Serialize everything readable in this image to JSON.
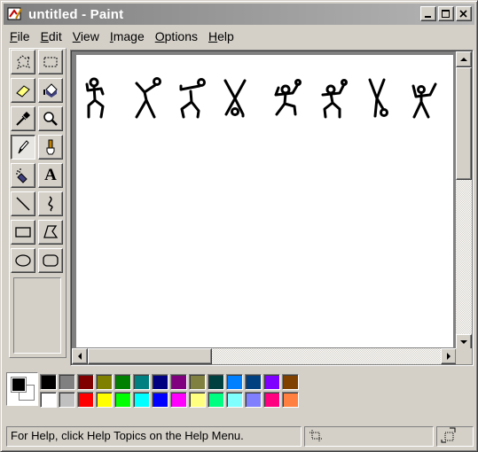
{
  "window": {
    "title": "untitled - Paint"
  },
  "titlebar": {
    "buttons": [
      "minimize",
      "maximize",
      "close"
    ]
  },
  "menubar": {
    "items": [
      {
        "label": "File",
        "key": "F",
        "rest": "ile"
      },
      {
        "label": "Edit",
        "key": "E",
        "rest": "dit"
      },
      {
        "label": "View",
        "key": "V",
        "rest": "iew"
      },
      {
        "label": "Image",
        "key": "I",
        "rest": "mage"
      },
      {
        "label": "Options",
        "key": "O",
        "rest": "ptions"
      },
      {
        "label": "Help",
        "key": "H",
        "rest": "elp"
      }
    ]
  },
  "tools": {
    "selected": "pencil",
    "items": [
      "free-form-select-icon",
      "select-icon",
      "eraser-icon",
      "fill-icon",
      "pick-color-icon",
      "magnifier-icon",
      "pencil-icon",
      "brush-icon",
      "airbrush-icon",
      "text-icon",
      "line-icon",
      "curve-icon",
      "rectangle-icon",
      "polygon-icon",
      "ellipse-icon",
      "rounded-rectangle-icon"
    ],
    "text_tool_glyph": "A"
  },
  "colors": {
    "foreground": "#000000",
    "background": "#ffffff",
    "palette_row1": [
      "#000000",
      "#808080",
      "#800000",
      "#808000",
      "#008000",
      "#008080",
      "#000080",
      "#800080",
      "#808040",
      "#004040",
      "#0080ff",
      "#004080",
      "#8000ff",
      "#804000"
    ],
    "palette_row2": [
      "#ffffff",
      "#c0c0c0",
      "#ff0000",
      "#ffff00",
      "#00ff00",
      "#00ffff",
      "#0000ff",
      "#ff00ff",
      "#ffff80",
      "#00ff80",
      "#80ffff",
      "#8080ff",
      "#ff0080",
      "#ff8040"
    ]
  },
  "canvas": {
    "drawing": "eight-dancing-stick-figures"
  },
  "statusbar": {
    "help_text": "For Help, click Help Topics on the Help Menu."
  }
}
